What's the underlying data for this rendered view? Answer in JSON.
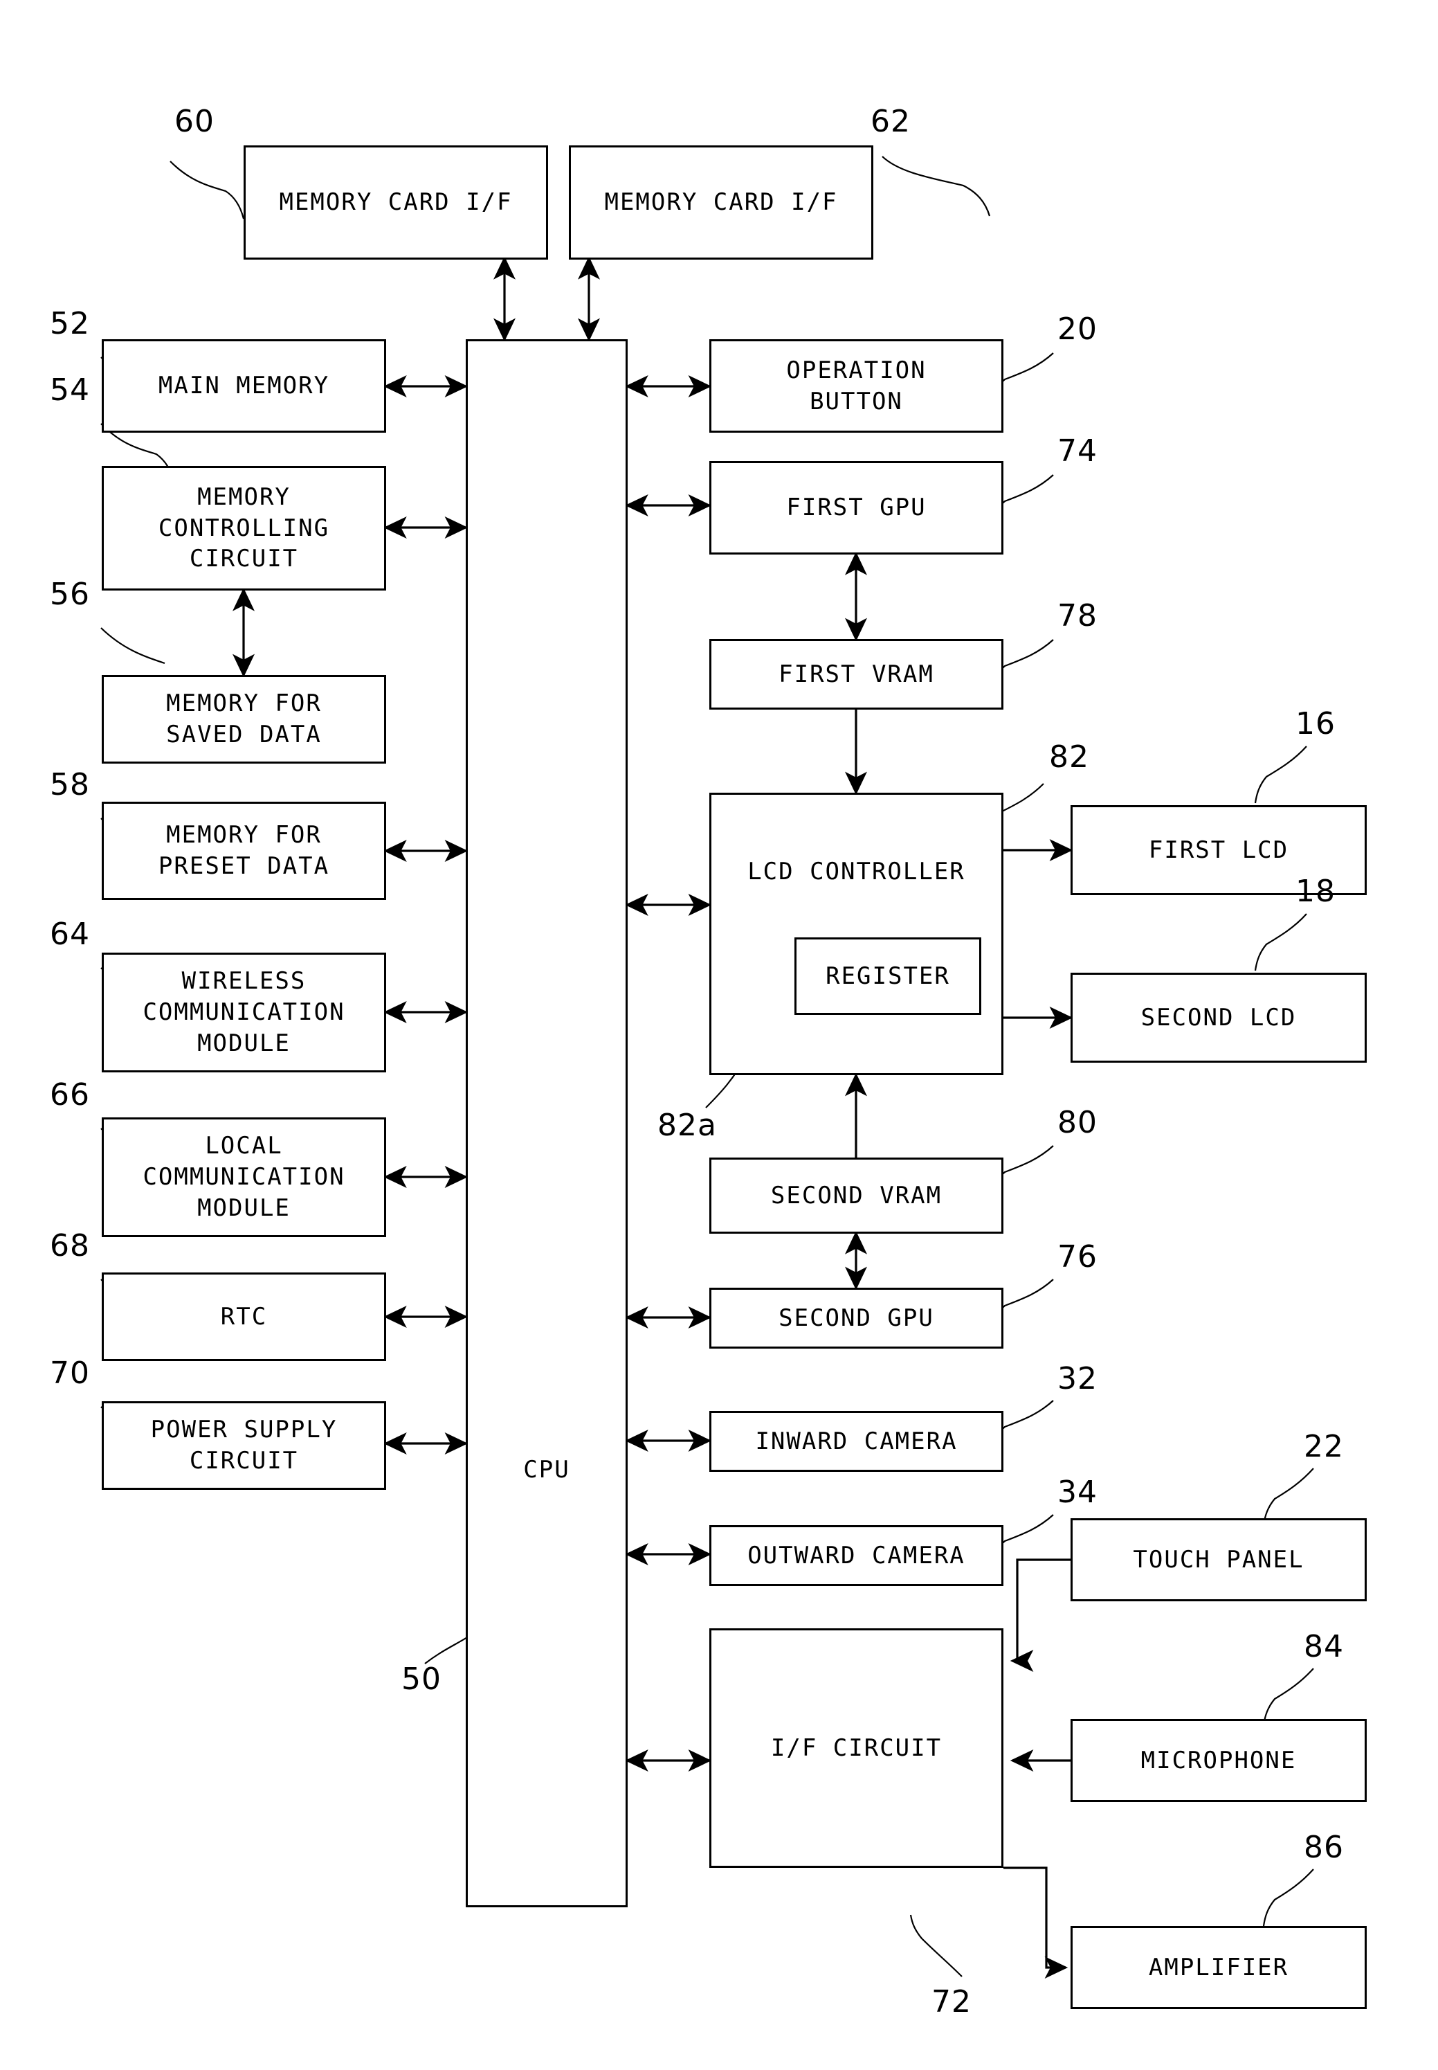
{
  "figure": {
    "type": "patent-block-diagram",
    "background": "#ffffff",
    "line_color": "#000000"
  },
  "blocks": {
    "memory_card_if_1": "MEMORY CARD I/F",
    "memory_card_if_2": "MEMORY CARD I/F",
    "main_memory": "MAIN MEMORY",
    "memory_controlling_circuit": "MEMORY\nCONTROLLING\nCIRCUIT",
    "memory_for_saved_data": "MEMORY FOR\nSAVED DATA",
    "memory_for_preset_data": "MEMORY FOR\nPRESET DATA",
    "wireless_communication_module": "WIRELESS\nCOMMUNICATION\nMODULE",
    "local_communication_module": "LOCAL\nCOMMUNICATION\nMODULE",
    "rtc": "RTC",
    "power_supply_circuit": "POWER SUPPLY\nCIRCUIT",
    "cpu": "CPU",
    "operation_button": "OPERATION\nBUTTON",
    "first_gpu": "FIRST GPU",
    "first_vram": "FIRST VRAM",
    "lcd_controller": "LCD CONTROLLER",
    "register": "REGISTER",
    "first_lcd": "FIRST LCD",
    "second_lcd": "SECOND LCD",
    "second_vram": "SECOND VRAM",
    "second_gpu": "SECOND GPU",
    "inward_camera": "INWARD CAMERA",
    "outward_camera": "OUTWARD CAMERA",
    "if_circuit": "I/F CIRCUIT",
    "touch_panel": "TOUCH PANEL",
    "microphone": "MICROPHONE",
    "amplifier": "AMPLIFIER"
  },
  "reference_numerals": {
    "memory_card_if_1": "60",
    "memory_card_if_2": "62",
    "main_memory": "52",
    "memory_controlling_circuit": "54",
    "memory_for_saved_data": "56",
    "memory_for_preset_data": "58",
    "wireless_communication_module": "64",
    "local_communication_module": "66",
    "rtc": "68",
    "power_supply_circuit": "70",
    "cpu": "50",
    "operation_button": "20",
    "first_gpu": "74",
    "first_vram": "78",
    "lcd_controller": "82",
    "register": "82a",
    "first_lcd": "16",
    "second_lcd": "18",
    "second_vram": "80",
    "second_gpu": "76",
    "inward_camera": "32",
    "outward_camera": "34",
    "if_circuit": "72",
    "touch_panel": "22",
    "microphone": "84",
    "amplifier": "86"
  }
}
